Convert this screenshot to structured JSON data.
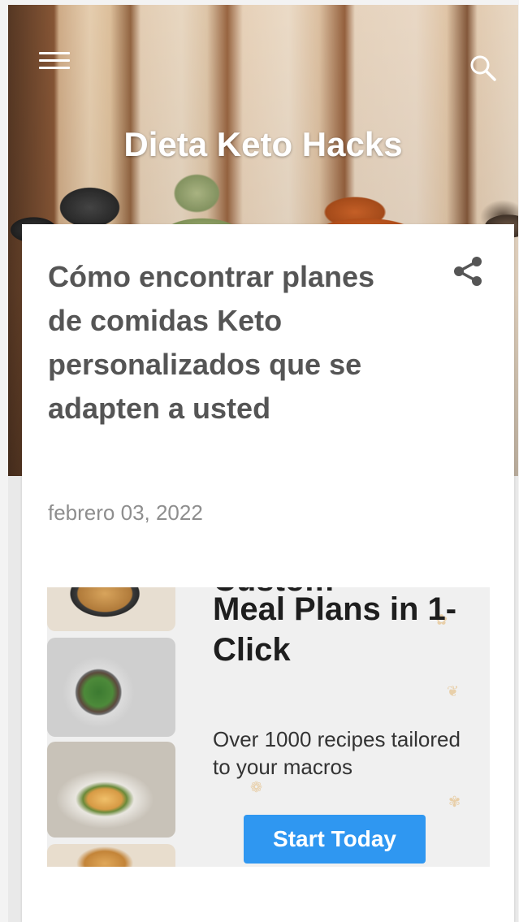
{
  "header": {
    "site_title": "Dieta Keto Hacks",
    "menu_icon": "hamburger-menu-icon",
    "search_icon": "search-icon"
  },
  "post": {
    "title": "Cómo encontrar planes de comidas Keto personalizados que se adapten a usted",
    "date": "febrero 03, 2022",
    "share_icon": "share-icon"
  },
  "ad": {
    "headline_cut": "Custom",
    "headline": "Meal Plans in 1-Click",
    "subtext": "Over 1000 recipes tailored to your macros",
    "cta_label": "Start Today",
    "cta_color": "#2f97f1"
  },
  "colors": {
    "title_text": "#555555",
    "date_text": "#8e8e8e",
    "card_bg": "#ffffff"
  }
}
